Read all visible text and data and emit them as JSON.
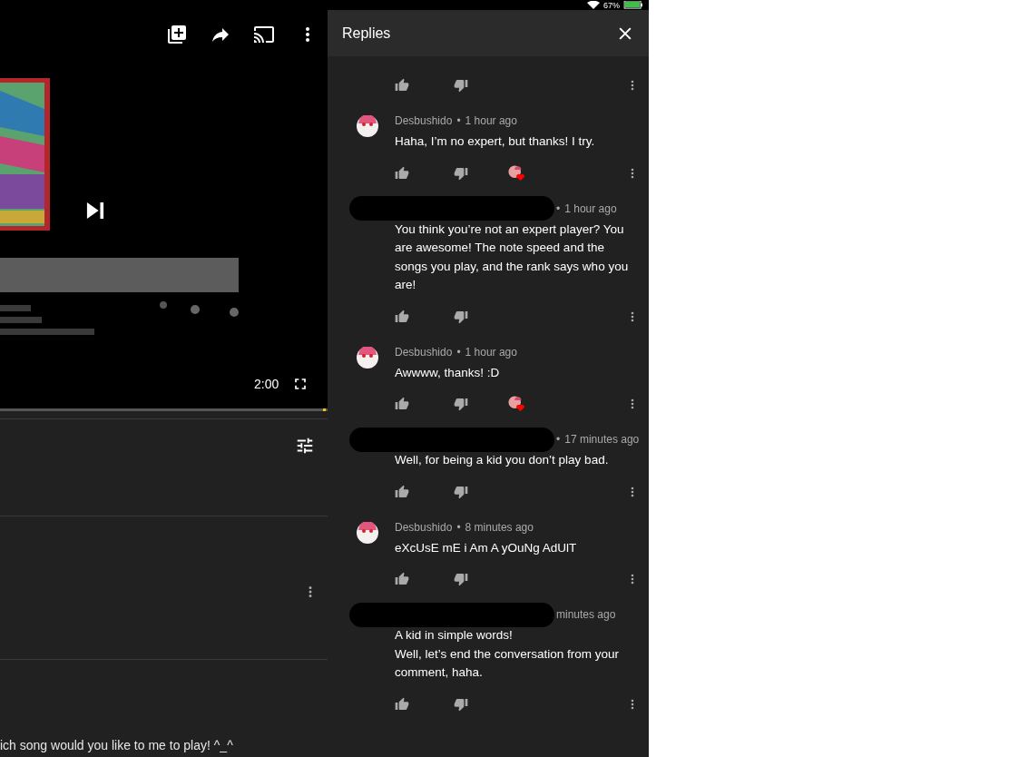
{
  "status_bar": {
    "battery": "67%"
  },
  "video": {
    "kind": "picture",
    "duration": "2:00"
  },
  "comments_panel": {
    "snippet": "ich song would you like to me to play! ^_^"
  },
  "replies": {
    "title": "Replies",
    "items": [
      {
        "kind": "tail",
        "hearted": false
      },
      {
        "kind": "comment",
        "redacted": false,
        "author": "Desbushido",
        "dot": "•",
        "time": "1 hour ago",
        "text": "Haha, I’m no expert, but thanks! I try.",
        "hearted": true
      },
      {
        "kind": "comment",
        "redacted": true,
        "dot": "•",
        "time": "1 hour ago",
        "text": "You think you’re not an expert player? You are awesome! The note speed and the songs you play, and the rank says who you are!",
        "hearted": false
      },
      {
        "kind": "comment",
        "redacted": false,
        "author": "Desbushido",
        "dot": "•",
        "time": "1 hour ago",
        "text": "Awwww, thanks! :D",
        "hearted": true
      },
      {
        "kind": "comment",
        "redacted": true,
        "dot": "•",
        "time": "17 minutes ago",
        "text": "Well, for being a kid you don’t play bad.",
        "hearted": false
      },
      {
        "kind": "comment",
        "redacted": false,
        "author": "Desbushido",
        "dot": "•",
        "time": "8 minutes ago",
        "text": "eXcUsE mE i Am A yOuNg AdUlT",
        "hearted": false
      },
      {
        "kind": "comment",
        "redacted": true,
        "time": "minutes ago",
        "text": "A kid in simple words!\nWell, let’s end the conversation from your comment, haha.",
        "hearted": false
      }
    ]
  }
}
